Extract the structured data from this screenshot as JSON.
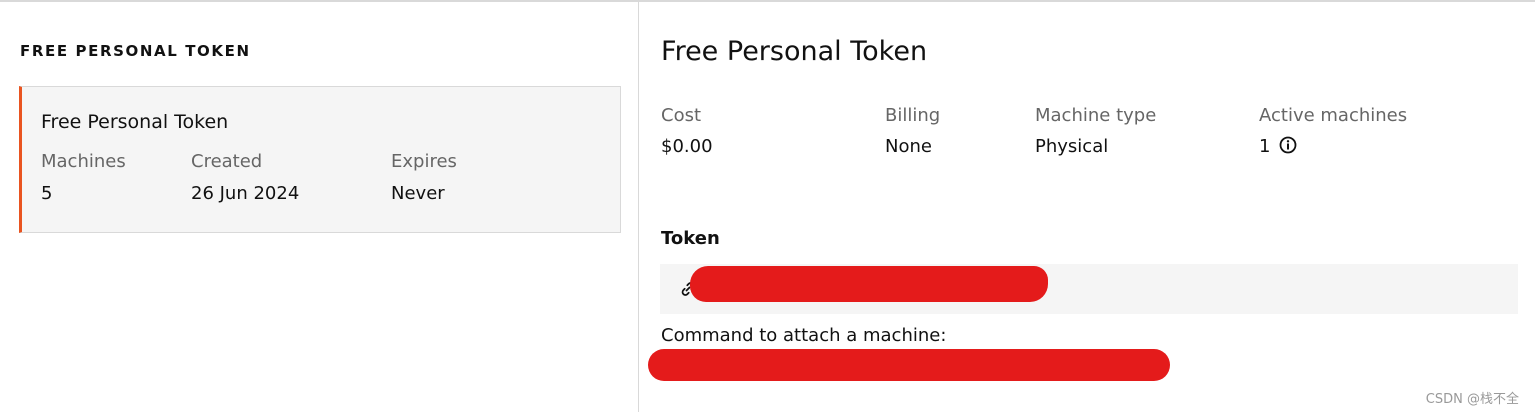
{
  "sidebar": {
    "heading": "FREE PERSONAL TOKEN",
    "card": {
      "title": "Free Personal Token",
      "fields": [
        {
          "label": "Machines",
          "value": "5"
        },
        {
          "label": "Created",
          "value": "26 Jun 2024"
        },
        {
          "label": "Expires",
          "value": "Never"
        }
      ]
    }
  },
  "detail": {
    "title": "Free Personal Token",
    "stats": [
      {
        "label": "Cost",
        "value": "$0.00"
      },
      {
        "label": "Billing",
        "value": "None"
      },
      {
        "label": "Machine type",
        "value": "Physical"
      },
      {
        "label": "Active machines",
        "value": "1"
      }
    ],
    "info_icon": "info-circle-icon",
    "token_heading": "Token",
    "token_icon": "link-icon",
    "attach_label": "Command to attach a machine:"
  },
  "watermark": "CSDN @栈不全",
  "colors": {
    "accent": "#e95420",
    "redaction": "#e41b1b",
    "card_background": "#f5f5f5"
  }
}
